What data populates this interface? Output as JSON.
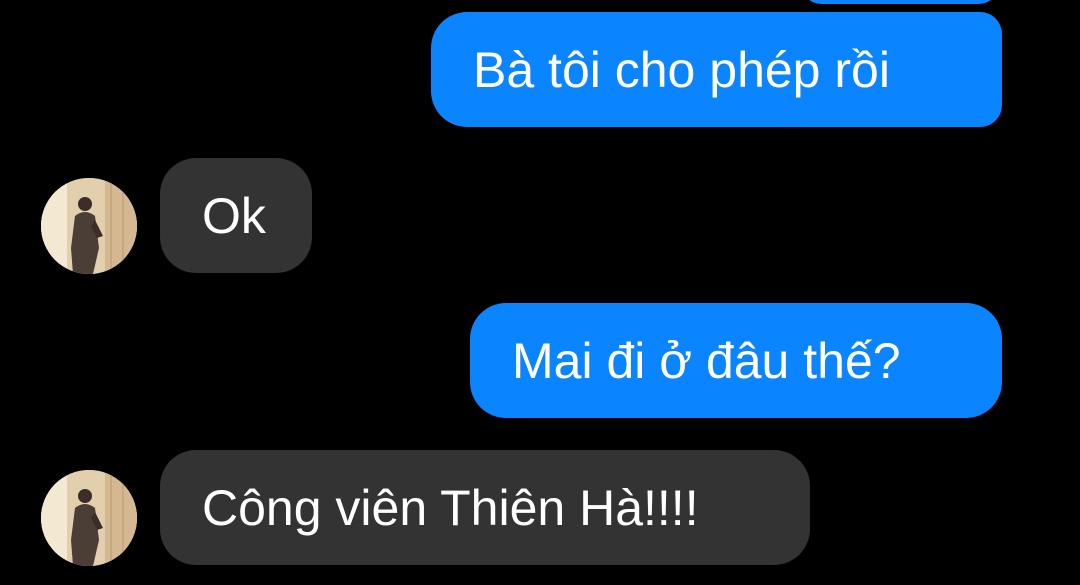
{
  "chat": {
    "messages": [
      {
        "sender": "me",
        "text": "Bà tôi cho phép rồi"
      },
      {
        "sender": "contact",
        "text": "Ok"
      },
      {
        "sender": "me",
        "text": "Mai đi ở đâu thế?"
      },
      {
        "sender": "contact",
        "text": "Công viên Thiên Hà!!!!"
      }
    ]
  },
  "colors": {
    "background": "#000000",
    "sent_bubble": "#0a84ff",
    "received_bubble": "#333333",
    "text": "#ffffff"
  },
  "icons": {
    "contact_avatar": "person-photo-avatar"
  }
}
